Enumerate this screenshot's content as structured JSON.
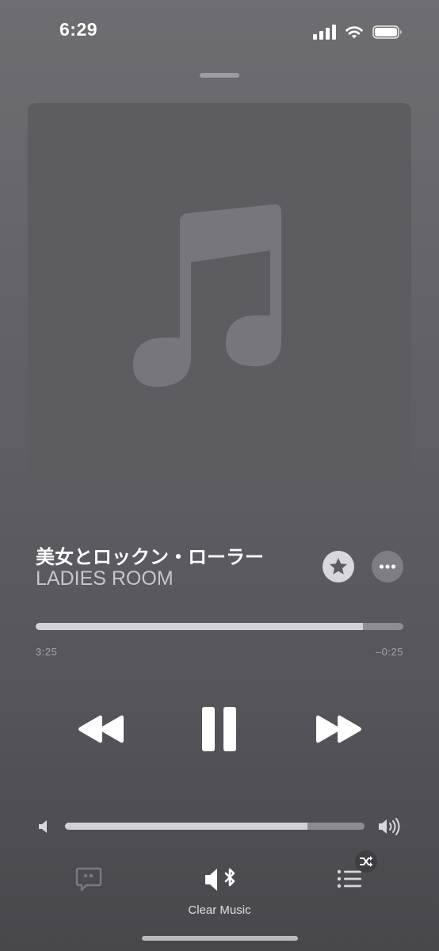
{
  "status_bar": {
    "time": "6:29",
    "signal_icon": "cellular-signal-icon",
    "wifi_icon": "wifi-icon",
    "battery_icon": "battery-icon",
    "battery_level": 1.0
  },
  "now_playing": {
    "artwork_icon": "music-note-icon",
    "title": "美女とロックン・ローラー",
    "artist": "LADIES ROOM",
    "favorite_icon": "star-icon",
    "more_icon": "ellipsis-icon"
  },
  "playback": {
    "elapsed": "3:25",
    "remaining": "–0:25",
    "progress_fraction": 0.891
  },
  "controls": {
    "rewind_icon": "rewind-icon",
    "pause_icon": "pause-icon",
    "forward_icon": "fast-forward-icon"
  },
  "volume": {
    "low_icon": "speaker-low-icon",
    "high_icon": "speaker-high-icon",
    "level_fraction": 0.81
  },
  "bottom_bar": {
    "lyrics_icon": "lyrics-quote-bubble-icon",
    "output_icon": "speaker-bluetooth-icon",
    "output_label": "Clear Music",
    "queue_icon": "queue-list-icon",
    "shuffle_icon": "shuffle-icon"
  },
  "colors": {
    "background_top": "#6d6d72",
    "background_bottom": "#47474c",
    "artwork_bg": "#5c5c61",
    "track_fill": "#d4d4d8",
    "track_bg": "#8d8d92"
  }
}
